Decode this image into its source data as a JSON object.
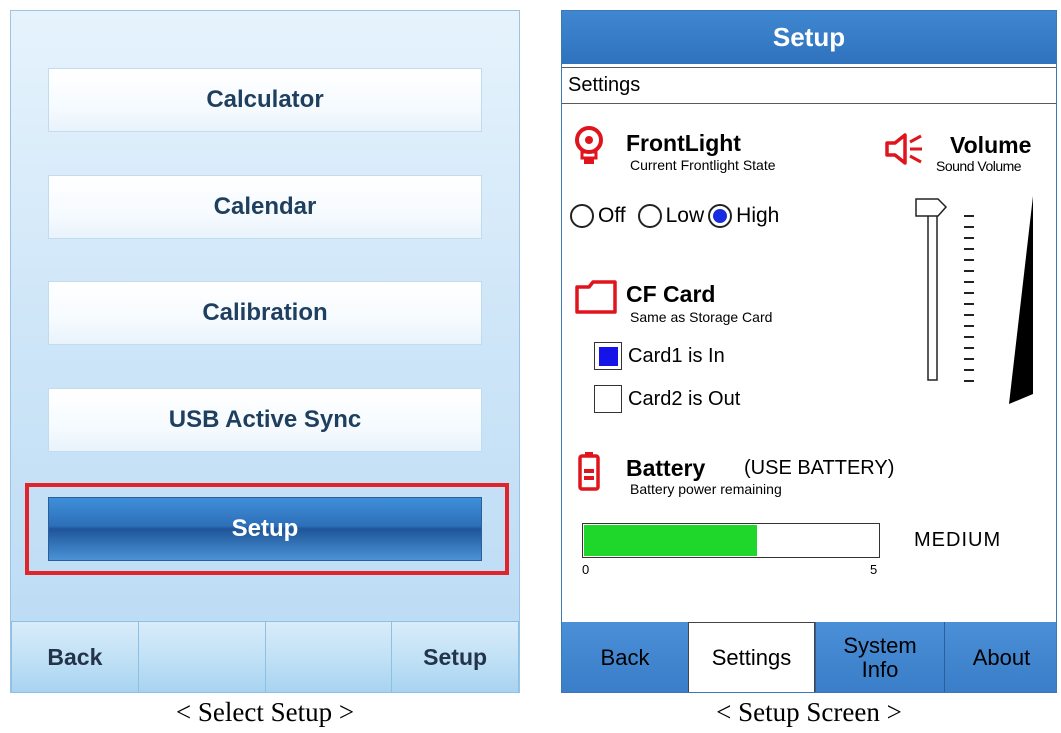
{
  "left_screen": {
    "menu": [
      "Calculator",
      "Calendar",
      "Calibration",
      "USB Active Sync",
      "Setup"
    ],
    "bottom_bar": [
      "Back",
      "",
      "",
      "Setup"
    ],
    "caption": "< Select Setup >"
  },
  "right_screen": {
    "title": "Setup",
    "subheader": "Settings",
    "frontlight": {
      "title": "FrontLight",
      "subtitle": "Current Frontlight State",
      "options": [
        "Off",
        "Low",
        "High"
      ],
      "selected": "High"
    },
    "volume": {
      "title": "Volume",
      "subtitle": "Sound Volume",
      "level": 1.0
    },
    "cf_card": {
      "title": "CF Card",
      "subtitle": "Same as Storage Card",
      "card1": {
        "label": "Card1 is In",
        "checked": true
      },
      "card2": {
        "label": "Card2 is Out",
        "checked": false
      }
    },
    "battery": {
      "title": "Battery",
      "status": "(USE BATTERY)",
      "subtitle": "Battery power remaining",
      "scale_min": "0",
      "scale_max": "5",
      "level": 2.95,
      "level_label": "MEDIUM",
      "fill_color": "#1ed72a"
    },
    "tabs": [
      "Back",
      "Settings",
      "System Info",
      "About"
    ],
    "active_tab": "Settings",
    "caption": "< Setup Screen >"
  },
  "colors": {
    "title_blue": "#2f72bd",
    "highlight_red": "#e0242a",
    "icon_red": "#e0141c",
    "radio_selected": "#1a2ce0"
  }
}
